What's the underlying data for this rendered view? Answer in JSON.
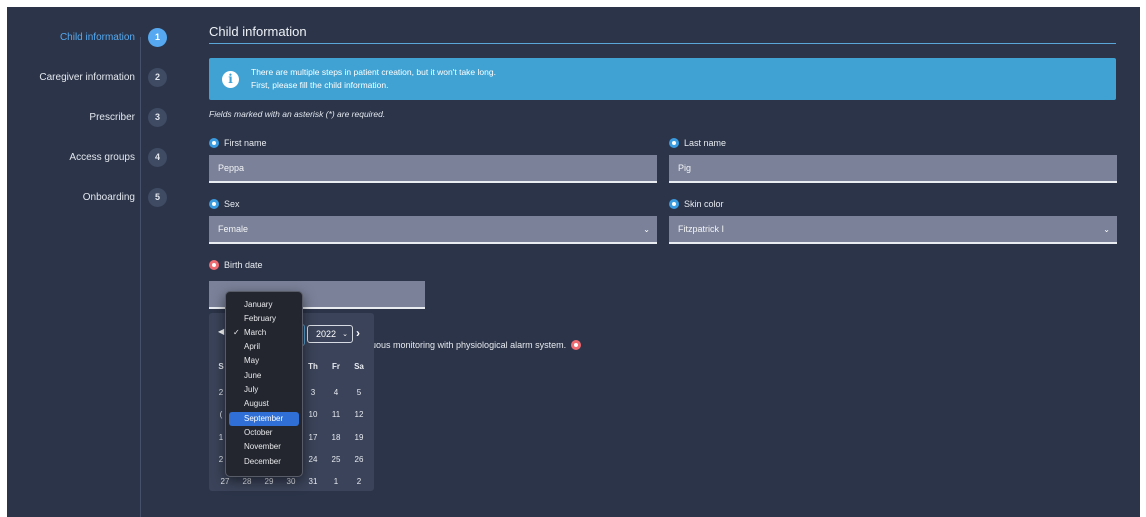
{
  "stepper": {
    "steps": [
      {
        "label": "Child information",
        "num": "1"
      },
      {
        "label": "Caregiver information",
        "num": "2"
      },
      {
        "label": "Prescriber",
        "num": "3"
      },
      {
        "label": "Access groups",
        "num": "4"
      },
      {
        "label": "Onboarding",
        "num": "5"
      }
    ],
    "active_index": 0
  },
  "main": {
    "title": "Child information",
    "info": {
      "icon": "info-icon",
      "line1": "There are multiple steps in patient creation, but it won't take long.",
      "line2": "First, please fill the child information."
    },
    "required_note": "Fields marked with an asterisk (*) are required.",
    "fields": {
      "first_name": {
        "label": "First name",
        "value": "Peppa"
      },
      "last_name": {
        "label": "Last name",
        "value": "Pig"
      },
      "sex": {
        "label": "Sex",
        "value": "Female"
      },
      "skin_color": {
        "label": "Skin color",
        "value": "Fitzpatrick I"
      },
      "birth_date": {
        "label": "Birth date",
        "value": ""
      }
    },
    "consent_text": "uous monitoring with physiological alarm system."
  },
  "datepicker": {
    "year": "2022",
    "weekday_heads": [
      "S",
      "Th",
      "Fr",
      "Sa"
    ],
    "rows": [
      [
        "2",
        "3",
        "4",
        "5"
      ],
      [
        "(",
        "10",
        "11",
        "12"
      ],
      [
        "1",
        "17",
        "18",
        "19"
      ],
      [
        "2",
        "24",
        "25",
        "26"
      ],
      [
        "27",
        "28",
        "29",
        "30",
        "31",
        "1",
        "2"
      ]
    ]
  },
  "month_menu": {
    "items": [
      "January",
      "February",
      "March",
      "April",
      "May",
      "June",
      "July",
      "August",
      "September",
      "October",
      "November",
      "December"
    ],
    "checked": "March",
    "highlighted": "September"
  },
  "colors": {
    "background": "#2b3448",
    "accent": "#56a9f0",
    "info_banner": "#3fa2d3",
    "required_dot": "#ef6b72",
    "menu_highlight": "#2f6fd6"
  }
}
